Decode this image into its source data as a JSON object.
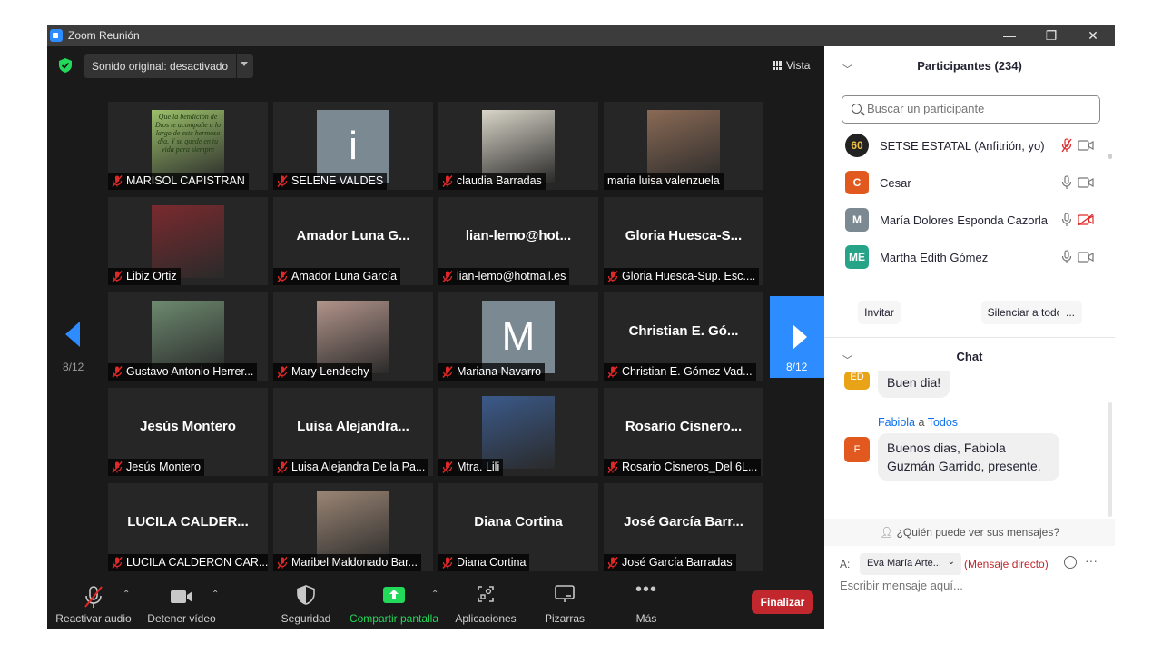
{
  "window": {
    "title": "Zoom Reunión",
    "controls": [
      "—",
      "❐",
      "✕"
    ]
  },
  "meeting": {
    "sound_dropdown": "Sonido original: desactivado",
    "view_button": "Vista",
    "page_indicator_left": "8/12",
    "page_indicator_right": "8/12",
    "tiles": [
      {
        "name": "MARISOL CAPISTRAN",
        "big": "",
        "kind": "photo",
        "color": "#9bbf6a",
        "muted": true
      },
      {
        "name": "SELENE VALDES",
        "big": "",
        "kind": "letter",
        "letter": "i",
        "muted": true
      },
      {
        "name": "claudia  Barradas",
        "big": "",
        "kind": "photo",
        "color": "#d9d5c8",
        "muted": true
      },
      {
        "name": "maria luisa valenzuela",
        "big": "",
        "kind": "photo",
        "color": "#8a6a55",
        "muted": false
      },
      {
        "name": "Libiz Ortiz",
        "big": "",
        "kind": "photo",
        "color": "#7a2a2e",
        "muted": true
      },
      {
        "name": "Amador Luna García",
        "big": "Amador Luna G...",
        "kind": "text",
        "muted": true
      },
      {
        "name": "lian-lemo@hotmail.es",
        "big": "lian-lemo@hot...",
        "kind": "text",
        "muted": true
      },
      {
        "name": "Gloria Huesca-Sup. Esc....",
        "big": "Gloria  Huesca-S...",
        "kind": "text",
        "muted": true
      },
      {
        "name": "Gustavo Antonio Herrer...",
        "big": "",
        "kind": "photo",
        "color": "#6d8a6f",
        "muted": true
      },
      {
        "name": "Mary Lendechy",
        "big": "",
        "kind": "photo",
        "color": "#b2948a",
        "muted": true
      },
      {
        "name": "Mariana Navarro",
        "big": "",
        "kind": "letter",
        "letter": "M",
        "muted": true
      },
      {
        "name": "Christian E. Gómez Vad...",
        "big": "Christian  E. Gó...",
        "kind": "text",
        "muted": true
      },
      {
        "name": "Jesús Montero",
        "big": "Jesús Montero",
        "kind": "text",
        "muted": true
      },
      {
        "name": "Luisa Alejandra De la Pa...",
        "big": "Luisa  Alejandra...",
        "kind": "text",
        "muted": true
      },
      {
        "name": "Mtra. Lili",
        "big": "",
        "kind": "photo",
        "color": "#3b5a8a",
        "muted": true
      },
      {
        "name": "Rosario Cisneros_Del 6L...",
        "big": "Rosario  Cisnero...",
        "kind": "text",
        "muted": true
      },
      {
        "name": "LUCILA CALDERON CAR...",
        "big": "LUCILA  CALDER...",
        "kind": "text",
        "muted": true
      },
      {
        "name": "Maribel Maldonado Bar...",
        "big": "",
        "kind": "photo",
        "color": "#9a8574",
        "muted": true
      },
      {
        "name": "Diana Cortina",
        "big": "Diana Cortina",
        "kind": "text",
        "muted": true
      },
      {
        "name": "José García Barradas",
        "big": "José García Barr...",
        "kind": "text",
        "muted": true
      }
    ],
    "tile_1_overlay": "Que la bendición de Dios te acompañe a lo largo de este hermoso día. Y se quede en tu vida para siempre"
  },
  "toolbar": {
    "unmute": "Reactivar audio",
    "stop_video": "Detener vídeo",
    "security": "Seguridad",
    "share": "Compartir pantalla",
    "apps": "Aplicaciones",
    "whiteboards": "Pizarras",
    "more": "Más",
    "end": "Finalizar"
  },
  "participants": {
    "header": "Participantes (234)",
    "search_placeholder": "Buscar un participante",
    "list": [
      {
        "initials": "60",
        "name": "SETSE ESTATAL (Anfitrión, yo)",
        "color": "#222222",
        "mic_muted": true,
        "cam_off": false
      },
      {
        "initials": "C",
        "name": "Cesar",
        "color": "#e2591f",
        "mic_muted": false,
        "cam_off": false
      },
      {
        "initials": "M",
        "name": "María Dolores Esponda Cazorla",
        "color": "#7b8a92",
        "mic_muted": false,
        "cam_off": true
      },
      {
        "initials": "ME",
        "name": "Martha Edith Gómez",
        "color": "#27a388",
        "mic_muted": false,
        "cam_off": false
      }
    ],
    "invite": "Invitar",
    "mute_all": "Silenciar a todos",
    "more": "..."
  },
  "chat": {
    "header": "Chat",
    "messages": [
      {
        "initials": "ED",
        "color": "#e8a317",
        "text": "Buen dia!"
      },
      {
        "initials": "F",
        "color": "#e2591f",
        "from": "Fabiola",
        "joiner": "a",
        "to": "Todos",
        "text": "Buenos dias, Fabiola Guzmán  Garrido, presente."
      }
    ],
    "who_can_see": "¿Quién puede ver sus mensajes?",
    "to_label": "A:",
    "recipient": "Eva María Arte...",
    "direct": "(Mensaje directo)",
    "input_placeholder": "Escribir mensaje aquí..."
  }
}
